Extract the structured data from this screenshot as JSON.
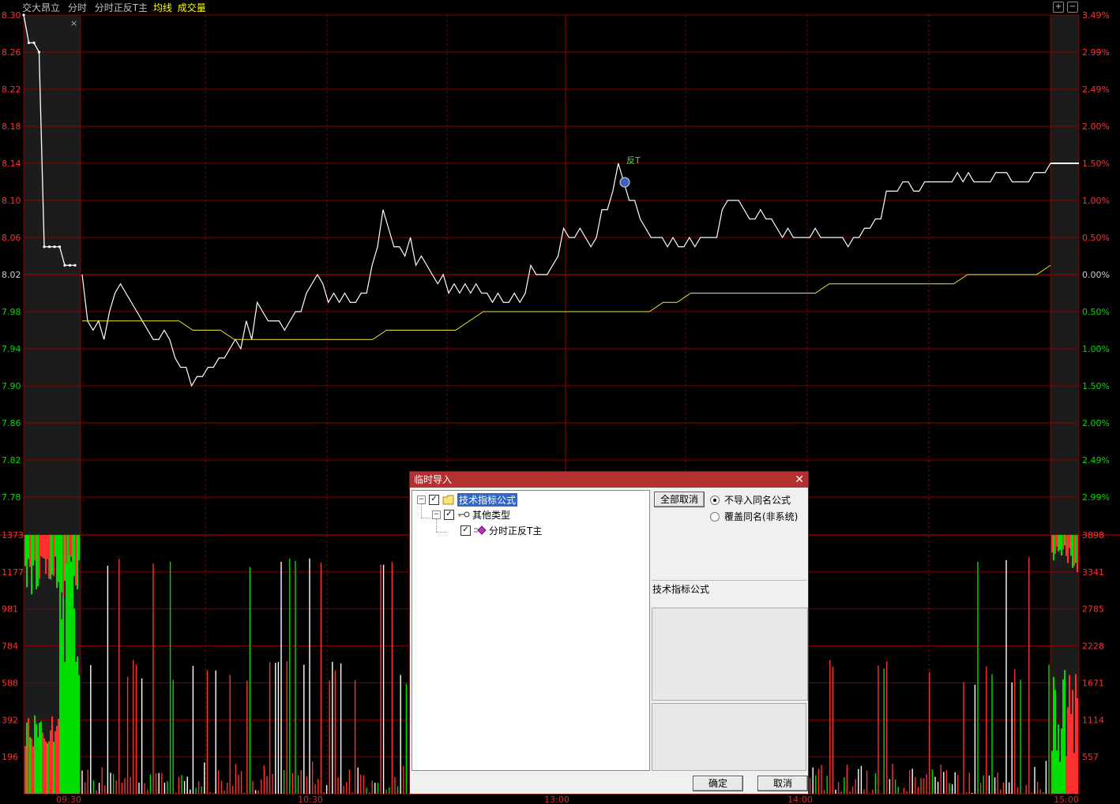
{
  "header": {
    "stock_name": "交大昂立",
    "mode": "分时",
    "indicator": "分时正反T主",
    "avg_line_label": "均线",
    "volume_label": "成交量",
    "colors": {
      "stock_name": "#c0c0c0",
      "indicator": "#c0c0c0",
      "avg_line_label": "#ffff00",
      "volume_label": "#ffff00"
    }
  },
  "window_buttons": [
    "+",
    "−"
  ],
  "chart_data": {
    "type": "line",
    "price_axis_left": [
      "8.30",
      "8.26",
      "8.22",
      "8.18",
      "8.14",
      "8.10",
      "8.06",
      "8.02",
      "7.98",
      "7.94",
      "7.90",
      "7.86",
      "7.82",
      "7.78"
    ],
    "pct_axis_right": [
      "3.49%",
      "2.99%",
      "2.49%",
      "2.00%",
      "1.50%",
      "1.00%",
      "0.50%",
      "0.00%",
      "0.50%",
      "1.00%",
      "1.50%",
      "2.00%",
      "2.49%",
      "2.99%"
    ],
    "volume_axis_left": [
      "1373",
      "1177",
      "981",
      "784",
      "588",
      "392",
      "196"
    ],
    "volume_axis_right": [
      "3898",
      "3341",
      "2785",
      "2228",
      "1671",
      "1114",
      "557"
    ],
    "time_labels": [
      "09:30",
      "10:30",
      "13:00",
      "14:00",
      "15:00"
    ],
    "prev_close": 8.02,
    "ylim": [
      7.76,
      8.3
    ],
    "signal_label": "反T",
    "colors": {
      "price": "#ffffff",
      "avg": "#e8e832",
      "grid": "#8b0000",
      "up": "#ff3030",
      "down": "#00dd00",
      "axis_up": "#ff3030",
      "axis_down": "#00dd00"
    },
    "price_series": [
      8.02,
      7.97,
      7.96,
      7.97,
      7.95,
      7.98,
      8.0,
      8.01,
      8.0,
      7.99,
      7.98,
      7.97,
      7.96,
      7.95,
      7.95,
      7.96,
      7.95,
      7.93,
      7.92,
      7.92,
      7.9,
      7.91,
      7.91,
      7.92,
      7.92,
      7.93,
      7.93,
      7.94,
      7.95,
      7.94,
      7.97,
      7.95,
      7.99,
      7.98,
      7.97,
      7.97,
      7.97,
      7.96,
      7.97,
      7.98,
      7.98,
      8.0,
      8.01,
      8.02,
      8.01,
      7.99,
      8.0,
      7.99,
      8.0,
      7.99,
      7.99,
      8.0,
      8.0,
      8.03,
      8.05,
      8.09,
      8.07,
      8.05,
      8.05,
      8.04,
      8.06,
      8.03,
      8.04,
      8.03,
      8.02,
      8.01,
      8.02,
      8.0,
      8.01,
      8.0,
      8.01,
      8.0,
      8.01,
      8.0,
      8.0,
      7.99,
      8.0,
      7.99,
      7.99,
      8.0,
      7.99,
      8.0,
      8.03,
      8.02,
      8.02,
      8.02,
      8.03,
      8.04,
      8.07,
      8.06,
      8.06,
      8.07,
      8.06,
      8.05,
      8.06,
      8.09,
      8.09,
      8.11,
      8.14,
      8.12,
      8.1,
      8.1,
      8.08,
      8.07,
      8.06,
      8.06,
      8.06,
      8.05,
      8.06,
      8.05,
      8.05,
      8.06,
      8.05,
      8.06,
      8.06,
      8.06,
      8.06,
      8.09,
      8.1,
      8.1,
      8.1,
      8.09,
      8.08,
      8.08,
      8.09,
      8.08,
      8.08,
      8.07,
      8.06,
      8.07,
      8.06,
      8.06,
      8.06,
      8.06,
      8.07,
      8.06,
      8.06,
      8.06,
      8.06,
      8.06,
      8.05,
      8.06,
      8.06,
      8.07,
      8.07,
      8.08,
      8.08,
      8.11,
      8.11,
      8.11,
      8.12,
      8.12,
      8.11,
      8.11,
      8.12,
      8.12,
      8.12,
      8.12,
      8.12,
      8.12,
      8.13,
      8.12,
      8.13,
      8.12,
      8.12,
      8.12,
      8.12,
      8.13,
      8.13,
      8.13,
      8.12,
      8.12,
      8.12,
      8.12,
      8.13,
      8.13,
      8.13,
      8.14
    ],
    "avg_series": [
      7.97,
      7.97,
      7.97,
      7.97,
      7.97,
      7.97,
      7.97,
      7.97,
      7.96,
      7.96,
      7.96,
      7.95,
      7.95,
      7.95,
      7.95,
      7.95,
      7.95,
      7.95,
      7.95,
      7.95,
      7.95,
      7.95,
      7.96,
      7.96,
      7.96,
      7.96,
      7.96,
      7.96,
      7.97,
      7.98,
      7.98,
      7.98,
      7.98,
      7.98,
      7.98,
      7.98,
      7.98,
      7.98,
      7.98,
      7.98,
      7.98,
      7.98,
      7.99,
      7.99,
      8.0,
      8.0,
      8.0,
      8.0,
      8.0,
      8.0,
      8.0,
      8.0,
      8.0,
      8.0,
      8.01,
      8.01,
      8.01,
      8.01,
      8.01,
      8.01,
      8.01,
      8.01,
      8.01,
      8.01,
      8.02,
      8.02,
      8.02,
      8.02,
      8.02,
      8.02,
      8.03
    ],
    "opening_spike": [
      8.3,
      8.27,
      8.27,
      8.26,
      8.05,
      8.05,
      8.05,
      8.05,
      8.03,
      8.03,
      8.03
    ],
    "closing_price": 8.14
  },
  "dialog": {
    "title": "临时导入",
    "close_glyph": "✕",
    "tree": {
      "root_label": "技术指标公式",
      "child_label": "其他类型",
      "leaf_label": "分时正反T主",
      "root_expander": "−",
      "child_expander": "−",
      "check_glyph": "✓"
    },
    "cancel_all_label": "全部取消",
    "radio_options": [
      {
        "label": "不导入同名公式",
        "checked": true
      },
      {
        "label": "覆盖同名(非系统)",
        "checked": false
      }
    ],
    "info_label": "技术指标公式",
    "ok_label": "确定",
    "cancel_label": "取消"
  }
}
